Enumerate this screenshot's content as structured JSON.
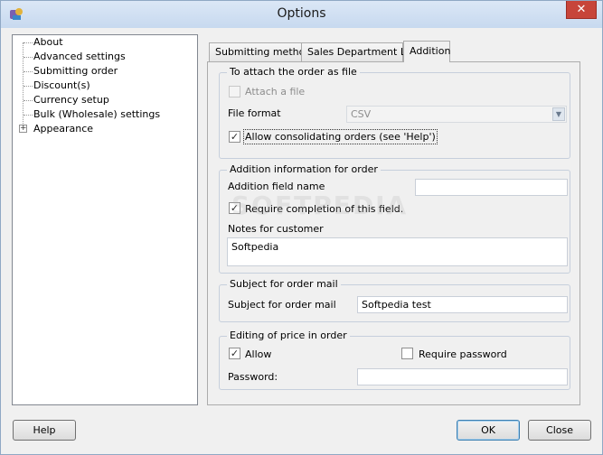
{
  "window": {
    "title": "Options",
    "close_glyph": "✕"
  },
  "tree": {
    "items": [
      {
        "label": "About"
      },
      {
        "label": "Advanced settings"
      },
      {
        "label": "Submitting order"
      },
      {
        "label": "Discount(s)"
      },
      {
        "label": "Currency setup"
      },
      {
        "label": "Bulk (Wholesale) settings"
      },
      {
        "label": "Appearance",
        "expandable": true,
        "expander": "+"
      }
    ]
  },
  "tabs": [
    {
      "label": "Submitting method",
      "active": false
    },
    {
      "label": "Sales Department List",
      "active": false
    },
    {
      "label": "Addition",
      "active": true
    }
  ],
  "attach_group": {
    "title": "To attach the order as file",
    "attach_file_label": "Attach a file",
    "attach_file_checked": false,
    "file_format_label": "File format",
    "file_format_value": "CSV",
    "allow_consolidating_label": "Allow consolidating orders (see 'Help')",
    "allow_consolidating_checked": true
  },
  "addition_group": {
    "title": "Addition information for order",
    "field_name_label": "Addition field name",
    "field_name_value": "",
    "require_completion_label": "Require completion of this field.",
    "require_completion_checked": true,
    "notes_label": "Notes for customer",
    "notes_value": "Softpedia"
  },
  "subject_group": {
    "title": "Subject for order mail",
    "subject_label": "Subject for order mail",
    "subject_value": "Softpedia test"
  },
  "price_group": {
    "title": "Editing of price in order",
    "allow_label": "Allow",
    "allow_checked": true,
    "require_password_label": "Require password",
    "require_password_checked": false,
    "password_label": "Password:",
    "password_value": ""
  },
  "buttons": {
    "help": "Help",
    "ok": "OK",
    "close": "Close"
  },
  "watermark": "SOFTPEDIA",
  "check_glyph": "✓"
}
